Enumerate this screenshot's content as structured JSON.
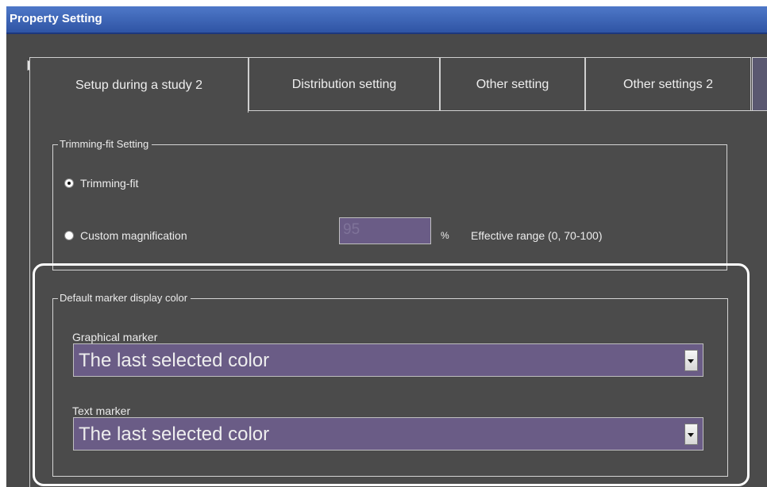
{
  "window": {
    "title": "Property Setting"
  },
  "tabs": [
    {
      "label": "Setup during a study 2"
    },
    {
      "label": "Distribution setting"
    },
    {
      "label": "Other setting"
    },
    {
      "label": "Other settings 2"
    }
  ],
  "trimming": {
    "legend": "Trimming-fit Setting",
    "option_fit": "Trimming-fit",
    "option_custom": "Custom magnification",
    "magnification_value": "95",
    "percent": "%",
    "effective_range": "Effective range (0, 70-100)",
    "selected": "Trimming-fit"
  },
  "marker": {
    "legend": "Default marker display color",
    "graphical_label": "Graphical marker",
    "graphical_value": "The last selected color",
    "text_label": "Text marker",
    "text_value": "The last selected color"
  },
  "colors": {
    "background": "#494949",
    "titlebar": "#2f54a4",
    "field": "#6a5c86",
    "highlight": "#ffffff"
  }
}
